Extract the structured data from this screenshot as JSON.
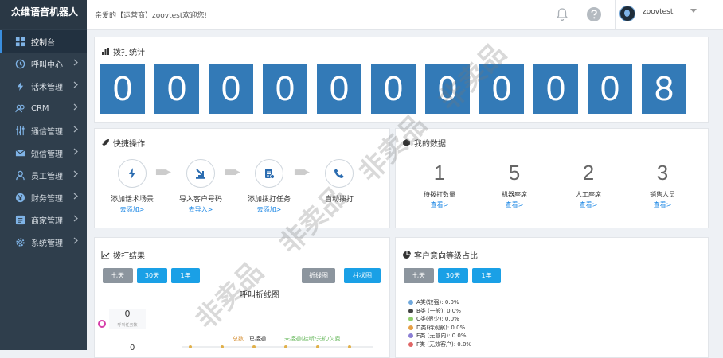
{
  "brand": "众维语音机器人",
  "welcome": "亲爱的【运营商】zoovtest欢迎您!",
  "user": {
    "name": "zoovtest"
  },
  "nav": [
    {
      "label": "控制台",
      "icon": "dashboard-icon",
      "active": true
    },
    {
      "label": "呼叫中心",
      "icon": "clock-icon"
    },
    {
      "label": "话术管理",
      "icon": "bolt-icon"
    },
    {
      "label": "CRM",
      "icon": "users-icon"
    },
    {
      "label": "通信管理",
      "icon": "sliders-icon"
    },
    {
      "label": "短信管理",
      "icon": "envelope-icon"
    },
    {
      "label": "员工管理",
      "icon": "user-icon"
    },
    {
      "label": "财务管理",
      "icon": "yen-icon"
    },
    {
      "label": "商家管理",
      "icon": "store-icon"
    },
    {
      "label": "系统管理",
      "icon": "gear-icon"
    }
  ],
  "dial_stats": {
    "title": "拨打统计",
    "digits": [
      "0",
      "0",
      "0",
      "0",
      "0",
      "0",
      "0",
      "0",
      "0",
      "0",
      "8"
    ]
  },
  "quick": {
    "title": "快捷操作",
    "items": [
      {
        "label": "添加话术场景",
        "link": "去添加>"
      },
      {
        "label": "导入客户号码",
        "link": "去导入>"
      },
      {
        "label": "添加拨打任务",
        "link": "去添加>"
      },
      {
        "label": "自动拨打",
        "link": ""
      }
    ]
  },
  "mydata": {
    "title": "我的数据",
    "items": [
      {
        "value": "1",
        "label": "待拨打数量",
        "link": "查看>"
      },
      {
        "value": "5",
        "label": "机器座席",
        "link": "查看>"
      },
      {
        "value": "2",
        "label": "人工座席",
        "link": "查看>"
      },
      {
        "value": "3",
        "label": "销售人员",
        "link": "查看>"
      }
    ]
  },
  "results": {
    "title": "拨打结果",
    "range_buttons": [
      "七天",
      "30天",
      "1年"
    ],
    "view_buttons": [
      "折线图",
      "柱状图"
    ],
    "chart_title": "呼叫折线图",
    "kpi_value": "0",
    "kpi_label": "呼叫任务数",
    "kpi_value2": "0",
    "series_legend": [
      "总数",
      "已接通",
      "未接通(挂断/关机/欠费"
    ]
  },
  "intent": {
    "title": "客户意向等级占比",
    "range_buttons": [
      "七天",
      "30天",
      "1年"
    ],
    "legend": [
      {
        "label": "A类(较强): 0.0%",
        "color": "#6fa8dc"
      },
      {
        "label": "B类 (一般): 0.0%",
        "color": "#434343"
      },
      {
        "label": "C类(很少): 0.0%",
        "color": "#8fce6a"
      },
      {
        "label": "D类(待观察): 0.0%",
        "color": "#e6a045"
      },
      {
        "label": "E类 (无意向): 0.0%",
        "color": "#8b7fd4"
      },
      {
        "label": "F类 (无效客户): 0.0%",
        "color": "#e06666"
      }
    ]
  },
  "watermark": "非卖品"
}
